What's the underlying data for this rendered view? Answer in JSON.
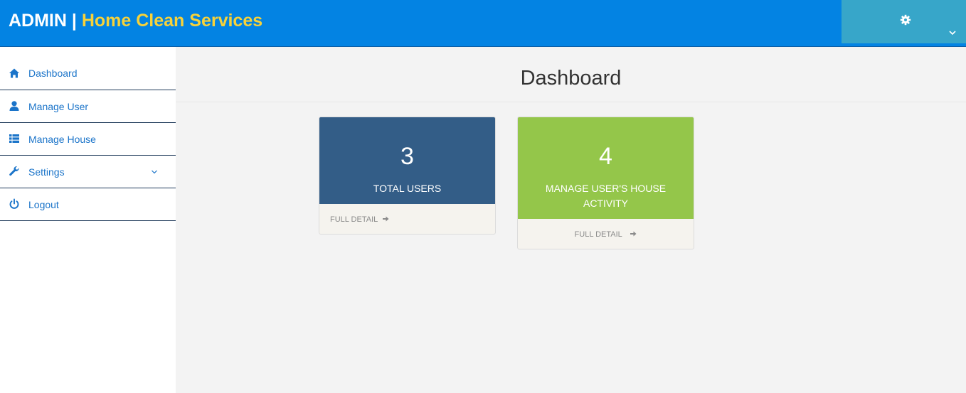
{
  "header": {
    "admin_label": "ADMIN",
    "separator": "|",
    "site_name": "Home Clean Services",
    "brand_color": "#0383e3",
    "site_name_color": "#f7d23a",
    "user_menu": {
      "icon": "gear-icon",
      "dropdown_icon": "chevron-down-icon",
      "color": "#37a6c9"
    }
  },
  "sidebar": {
    "items": [
      {
        "label": "Dashboard",
        "icon": "home-icon"
      },
      {
        "label": "Manage User",
        "icon": "user-icon"
      },
      {
        "label": "Manage House",
        "icon": "list-icon"
      },
      {
        "label": "Settings",
        "icon": "wrench-icon",
        "has_submenu": true
      },
      {
        "label": "Logout",
        "icon": "power-icon"
      }
    ]
  },
  "main": {
    "title": "Dashboard",
    "cards": [
      {
        "value": "3",
        "caption": "TOTAL USERS",
        "link": "FULL DETAIL",
        "color": "#335d87"
      },
      {
        "value": "4",
        "caption": "MANAGE USER'S HOUSE ACTIVITY",
        "link": "FULL DETAIL",
        "color": "#94c64a"
      }
    ]
  }
}
